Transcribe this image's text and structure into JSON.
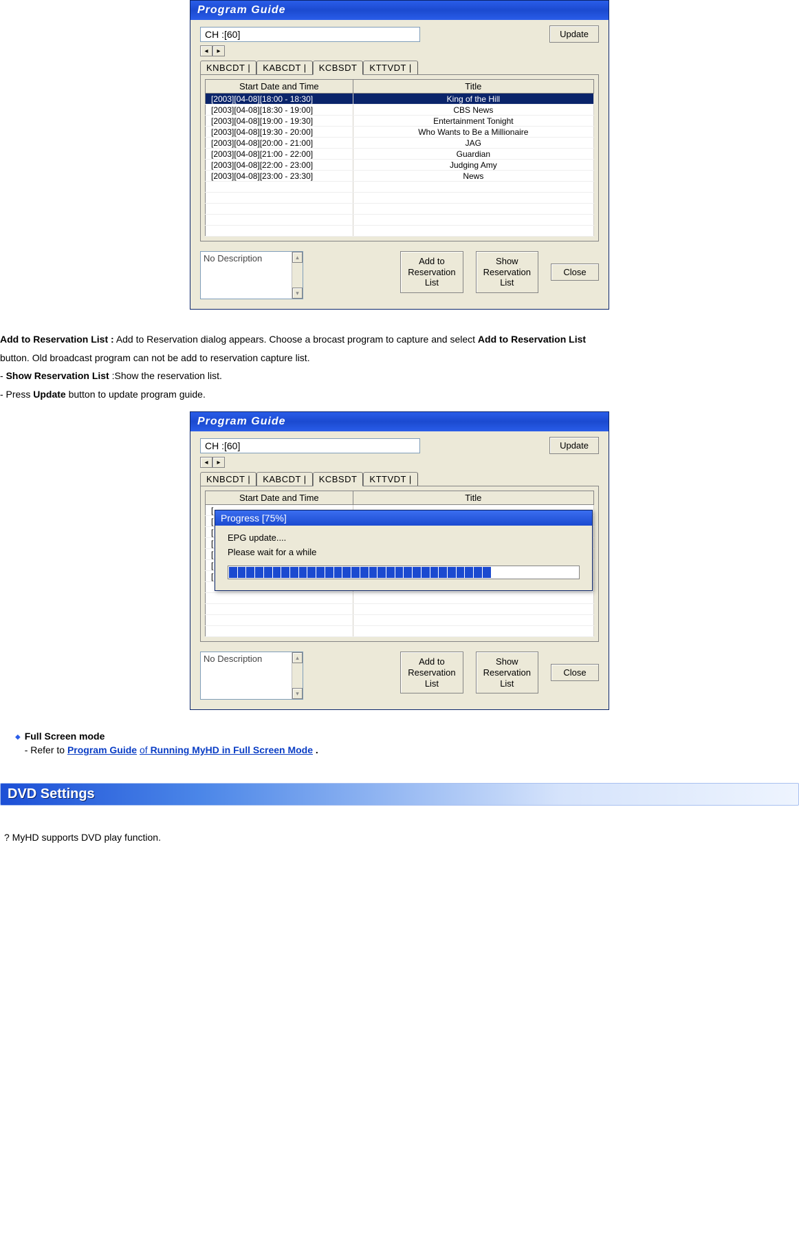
{
  "dialog": {
    "title": "Program Guide",
    "channel": "CH :[60]",
    "update_btn": "Update",
    "tabs": [
      "KNBCDT",
      "KABCDT",
      "KCBSDT",
      "KTTVDT"
    ],
    "active_tab": 2,
    "columns": [
      "Start Date and Time",
      "Title"
    ],
    "rows": [
      {
        "time": "[2003][04-08][18:00 - 18:30]",
        "title": "King of the Hill",
        "sel": true
      },
      {
        "time": "[2003][04-08][18:30 - 19:00]",
        "title": "CBS News",
        "sel": false
      },
      {
        "time": "[2003][04-08][19:00 - 19:30]",
        "title": "Entertainment Tonight",
        "sel": false
      },
      {
        "time": "[2003][04-08][19:30 - 20:00]",
        "title": "Who Wants to Be a Millionaire",
        "sel": false
      },
      {
        "time": "[2003][04-08][20:00 - 21:00]",
        "title": "JAG",
        "sel": false
      },
      {
        "time": "[2003][04-08][21:00 - 22:00]",
        "title": "Guardian",
        "sel": false
      },
      {
        "time": "[2003][04-08][22:00 - 23:00]",
        "title": "Judging Amy",
        "sel": false
      },
      {
        "time": "[2003][04-08][23:00 - 23:30]",
        "title": "News",
        "sel": false
      }
    ],
    "empty_rows": 5,
    "desc": "No Description",
    "btn_add": "Add to\nReservation\nList",
    "btn_show": "Show\nReservation\nList",
    "btn_close": "Close"
  },
  "text": {
    "p1a": "Add to Reservation List :",
    "p1b": "  Add to Reservation dialog appears. Choose a brocast program to capture and select ",
    "p1c": "Add to Reservation List",
    "p2": "button. Old broadcast program can not be add to reservation capture list.",
    "p3a": "- ",
    "p3b": "Show Reservation List",
    "p3c": " :Show the reservation list.",
    "p4a": "- Press ",
    "p4b": "Update",
    "p4c": " button to update program guide."
  },
  "progress": {
    "title": "Progress [75%]",
    "line1": "EPG update....",
    "line2": "Please wait for a while",
    "filled": 30,
    "total": 40
  },
  "fullscreen": {
    "heading": "Full Screen mode",
    "refer_pre": "- Refer to ",
    "link1": "Program Guide",
    "mid": " of ",
    "link2": "Running MyHD in Full Screen Mode",
    "period": "."
  },
  "dvd": {
    "header": "DVD Settings",
    "line": "?    MyHD supports DVD play function."
  }
}
